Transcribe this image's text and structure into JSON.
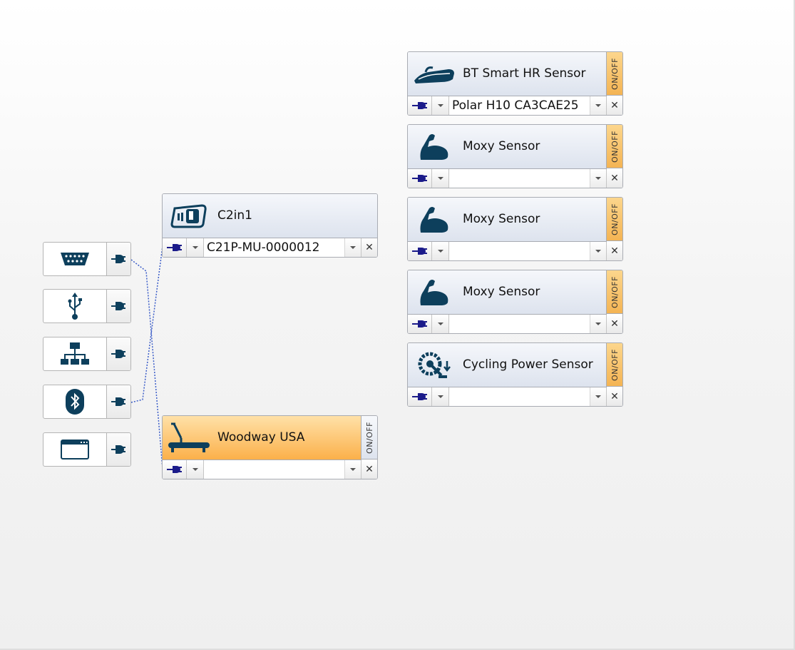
{
  "ports": [
    {
      "icon": "serial-port-icon",
      "plug_icon": "plug-icon"
    },
    {
      "icon": "usb-icon",
      "plug_icon": "plug-icon"
    },
    {
      "icon": "network-icon",
      "plug_icon": "plug-icon"
    },
    {
      "icon": "bluetooth-icon",
      "plug_icon": "plug-icon"
    },
    {
      "icon": "app-window-icon",
      "plug_icon": "plug-icon"
    }
  ],
  "devices": {
    "c2in1": {
      "title": "C2in1",
      "value": "C21P-MU-0000012",
      "icon": "handheld-device-icon"
    },
    "woodway": {
      "title": "Woodway USA",
      "value": "",
      "onoff": "ON/OFF",
      "icon": "treadmill-icon"
    },
    "hr": {
      "title": "BT Smart HR Sensor",
      "value": "Polar H10 CA3CAE25",
      "onoff": "ON/OFF",
      "icon": "heart-rate-strap-icon"
    },
    "moxy1": {
      "title": "Moxy Sensor",
      "value": "",
      "onoff": "ON/OFF",
      "icon": "muscle-arm-icon"
    },
    "moxy2": {
      "title": "Moxy Sensor",
      "value": "",
      "onoff": "ON/OFF",
      "icon": "muscle-arm-icon"
    },
    "moxy3": {
      "title": "Moxy Sensor",
      "value": "",
      "onoff": "ON/OFF",
      "icon": "muscle-arm-icon"
    },
    "power": {
      "title": "Cycling Power Sensor",
      "value": "",
      "onoff": "ON/OFF",
      "icon": "crank-power-icon"
    }
  },
  "common": {
    "remove_symbol": "✕"
  },
  "colors": {
    "icon": "#0d3f5c",
    "plug": "#1b1b8a",
    "link_line": "#3a5cc8",
    "active_header": "#fbb04a"
  }
}
